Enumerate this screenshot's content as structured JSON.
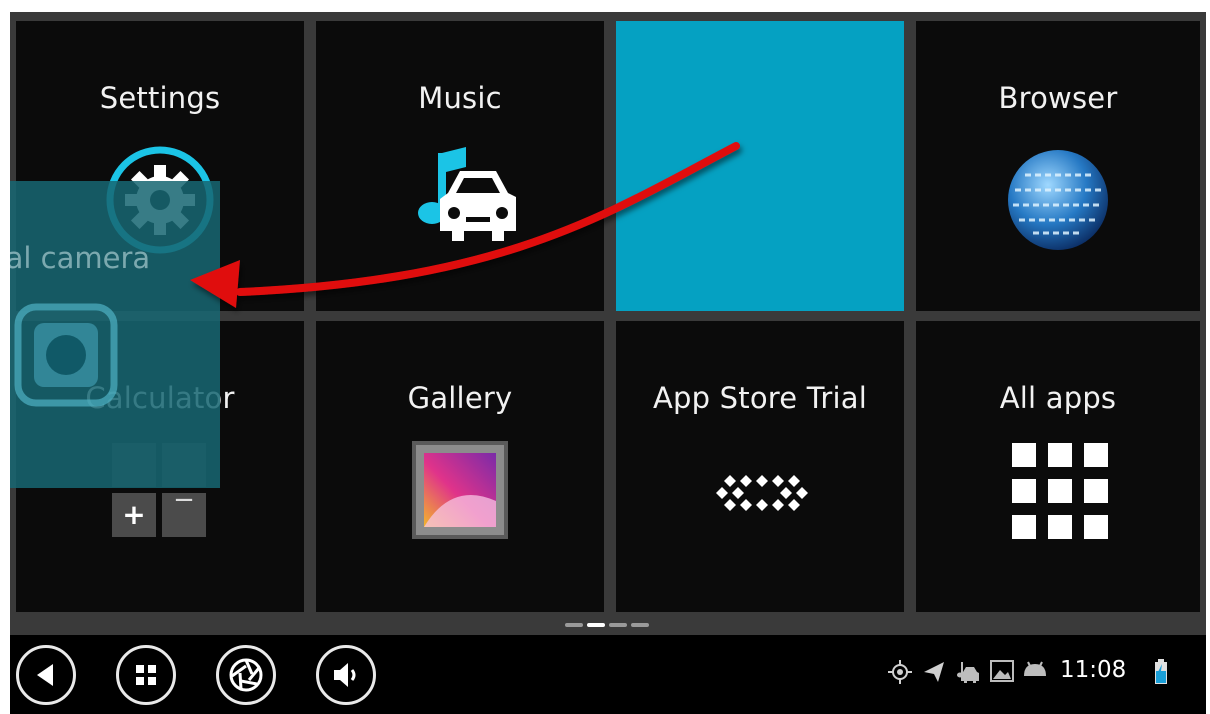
{
  "tiles": [
    {
      "label": "Settings",
      "icon": "settings-gear-icon"
    },
    {
      "label": "Music",
      "icon": "music-car-icon"
    },
    {
      "label": "",
      "icon": ""
    },
    {
      "label": "Browser",
      "icon": "globe-icon"
    },
    {
      "label": "Calculator",
      "icon": "calculator-icon"
    },
    {
      "label": "Gallery",
      "icon": "gallery-icon"
    },
    {
      "label": "App Store Trial",
      "icon": "app-store-icon"
    },
    {
      "label": "All apps",
      "icon": "all-apps-grid-icon"
    }
  ],
  "dragged_tile": {
    "label": "External camera",
    "visible_label": "ernal camera",
    "icon": "camera-icon"
  },
  "calculator": {
    "plus": "+",
    "minus": "−",
    "minus2": "−"
  },
  "pager": {
    "pages": 4,
    "active_index": 1
  },
  "taskbar": {
    "buttons": [
      "back-icon",
      "apps-icon",
      "camera-shutter-icon",
      "volume-icon"
    ],
    "status_icons": [
      "gps-icon",
      "navigation-arrow-icon",
      "music-car-icon",
      "image-icon",
      "android-icon",
      "battery-charging-icon"
    ],
    "clock": "11:08"
  },
  "colors": {
    "accent": "#05A1C2",
    "tile_bg": "#0B0B0B",
    "grid_gap": "#3A3A3A",
    "drag_overlay": "#176672",
    "arrow": "#E01010"
  }
}
